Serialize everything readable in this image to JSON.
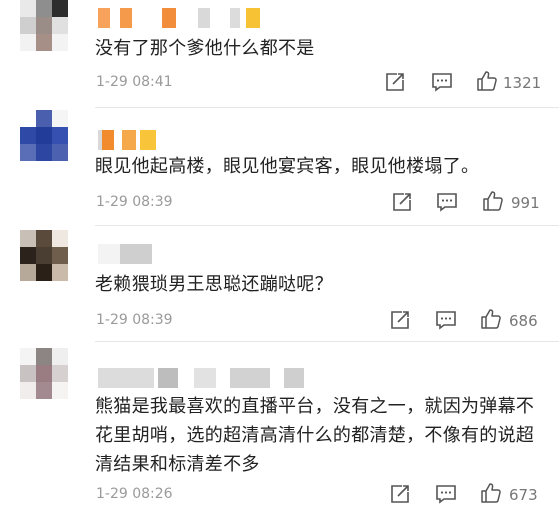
{
  "comments": [
    {
      "text": "没有了那个爹他什么都不是",
      "time": "1-29 08:41",
      "likes": "1321"
    },
    {
      "text": "眼见他起高楼，眼见他宴宾客，眼见他楼塌了。",
      "time": "1-29 08:39",
      "likes": "991"
    },
    {
      "text": "老赖猥琐男王思聪还蹦哒呢？",
      "time": "1-29 08:39",
      "likes": "686"
    },
    {
      "text": "熊猫是我最喜欢的直播平台，没有之一，就因为弹幕不花里胡哨，选的超清高清什么的都清楚，不像有的说超清结果和标清差不多",
      "time": "1-29 08:26",
      "likes": "673"
    }
  ],
  "icons": {
    "repost": "repost-icon",
    "reply": "comment-icon",
    "like": "thumbs-up-icon"
  }
}
